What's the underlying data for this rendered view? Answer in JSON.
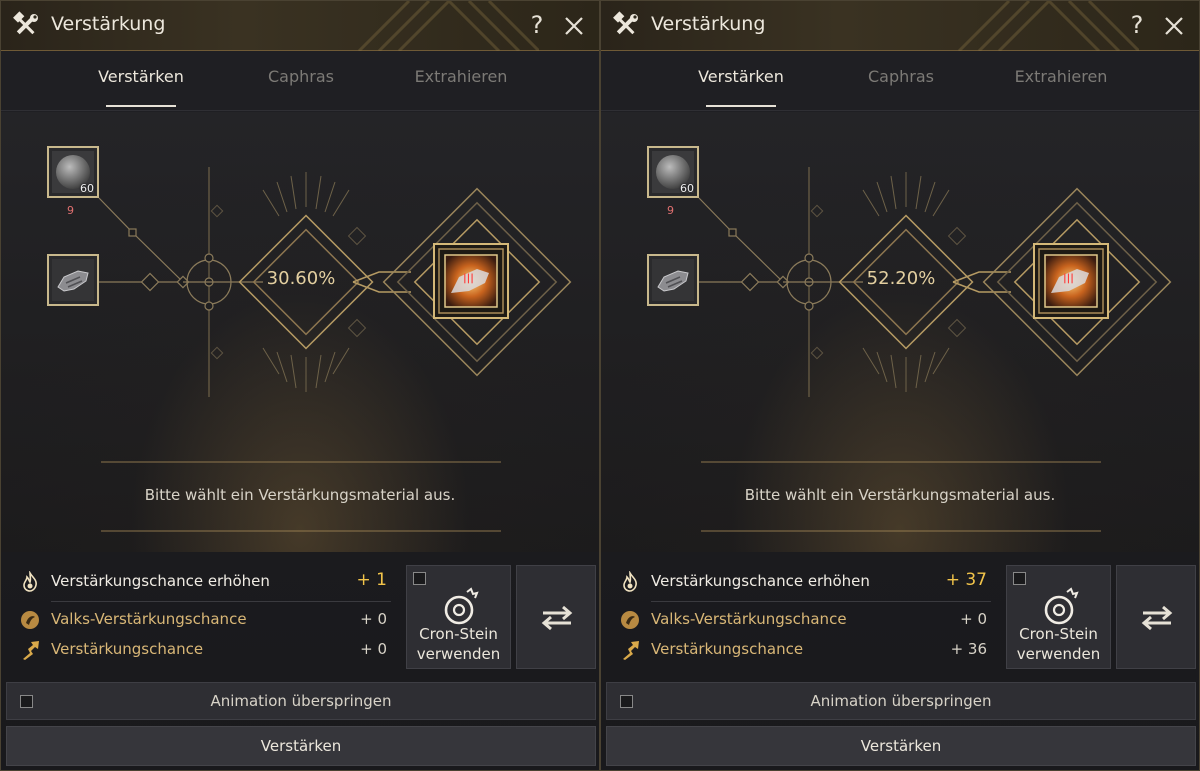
{
  "panels": [
    {
      "title": "Verstärkung",
      "help": "?",
      "tabs": [
        "Verstärken",
        "Caphras",
        "Extrahieren"
      ],
      "stone_count": "60",
      "stone_qty": "9",
      "success_chance": "30.60%",
      "hint": "Bitte wählt ein Verstärkungsmaterial aus.",
      "stats": {
        "boost_label": "Verstärkungschance erhöhen",
        "boost_value": "+ 1",
        "valks_label": "Valks-Verstärkungschance",
        "valks_value": "+ 0",
        "chance_label": "Verstärkungschance",
        "chance_value": "+ 0"
      },
      "cron_label_1": "Cron-Stein",
      "cron_label_2": "verwenden",
      "skip_animation": "Animation überspringen",
      "enhance_button": "Verstärken"
    },
    {
      "title": "Verstärkung",
      "help": "?",
      "tabs": [
        "Verstärken",
        "Caphras",
        "Extrahieren"
      ],
      "stone_count": "60",
      "stone_qty": "9",
      "success_chance": "52.20%",
      "hint": "Bitte wählt ein Verstärkungsmaterial aus.",
      "stats": {
        "boost_label": "Verstärkungschance erhöhen",
        "boost_value": "+ 37",
        "valks_label": "Valks-Verstärkungschance",
        "valks_value": "+ 0",
        "chance_label": "Verstärkungschance",
        "chance_value": "+ 36"
      },
      "cron_label_1": "Cron-Stein",
      "cron_label_2": "verwenden",
      "skip_animation": "Animation überspringen",
      "enhance_button": "Verstärken"
    }
  ],
  "icons": {
    "title": "hammer-wrench-icon",
    "close": "close-icon",
    "stone": "black-stone-icon",
    "gear": "gauntlet-icon",
    "result": "enhanced-gear-icon",
    "boost": "flame-icon",
    "valks": "valks-advice-icon",
    "chance": "up-arrow-icon",
    "cron": "cron-stone-icon",
    "swap": "swap-arrows-icon"
  },
  "colors": {
    "accent_gold": "#f2c44a",
    "label_gold": "#d9b777",
    "frame_gold": "#c8b88c",
    "count_red": "#e07070"
  }
}
